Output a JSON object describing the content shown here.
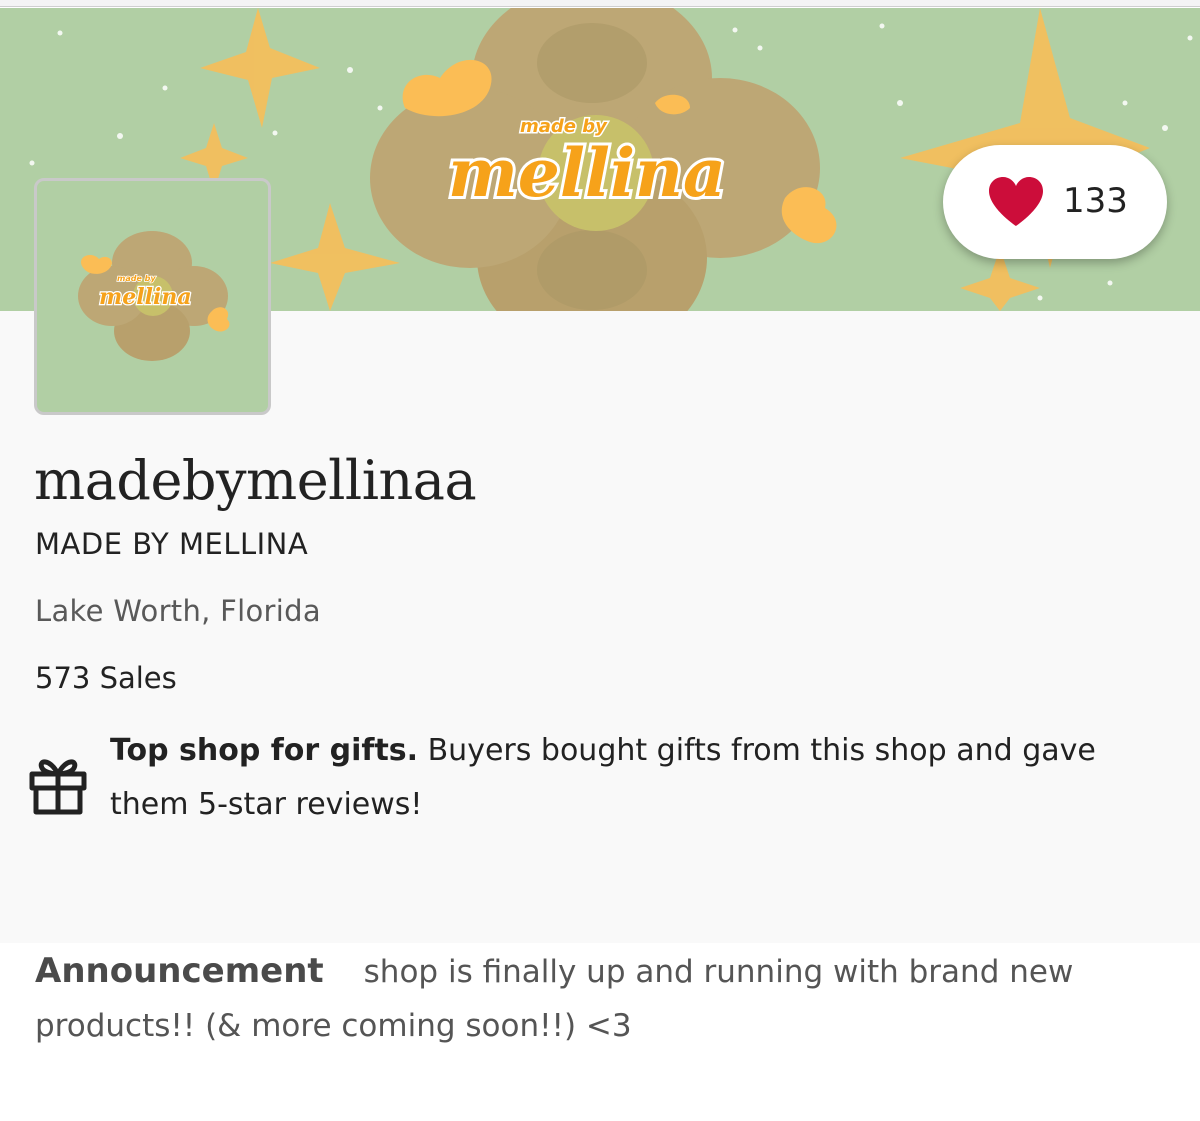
{
  "banner": {
    "logo_small": "made by",
    "logo_main": "mellina",
    "background_color": "#b1cfa4"
  },
  "favorites": {
    "count": "133",
    "icon": "heart-icon",
    "heart_color": "#cc0d3a"
  },
  "avatar": {
    "logo_small": "made by",
    "logo_main": "mellina"
  },
  "shop": {
    "handle": "madebymellinaa",
    "title": "MADE BY MELLINA",
    "location": "Lake Worth, Florida",
    "sales": "573 Sales"
  },
  "badge": {
    "icon": "gift-icon",
    "strong": "Top shop for gifts.",
    "text": " Buyers bought gifts from this shop and gave them 5-star reviews!"
  },
  "announcement": {
    "label": "Announcement",
    "text": "shop is finally up and running with brand new products!! (& more coming soon!!) <3"
  }
}
